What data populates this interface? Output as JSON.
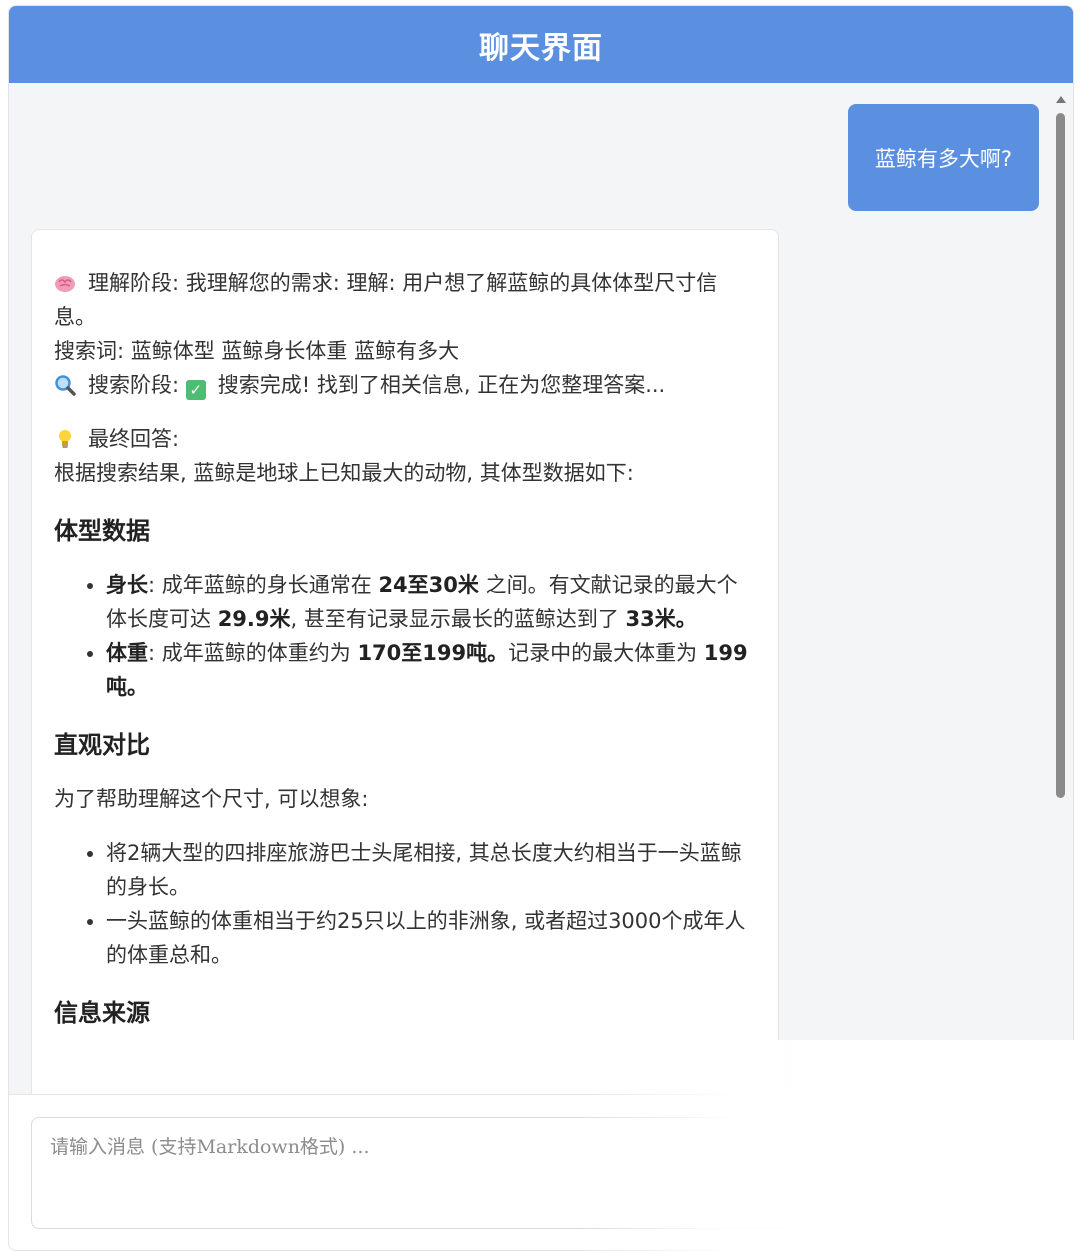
{
  "header": {
    "title": "聊天界面"
  },
  "messages": {
    "user": "蓝鲸有多大啊?",
    "ai": {
      "understanding_label": "理解阶段:",
      "understanding_text": "我理解您的需求: 理解: 用户想了解蓝鲸的具体体型尺寸信息。",
      "keywords": "搜索词: 蓝鲸体型 蓝鲸身长体重 蓝鲸有多大",
      "search_label": "搜索阶段:",
      "search_text": "搜索完成! 找到了相关信息, 正在为您整理答案...",
      "final_label": "最终回答:",
      "intro": "根据搜索结果, 蓝鲸是地球上已知最大的动物, 其体型数据如下:",
      "section1_title": "体型数据",
      "length_label": "身长",
      "length_a": ": 成年蓝鲸的身长通常在 ",
      "length_b": "24至30米",
      "length_c": " 之间。有文献记录的最大个体长度可达 ",
      "length_d": "29.9米",
      "length_e": ", 甚至有记录显示最长的蓝鲸达到了 ",
      "length_f": "33米。",
      "weight_label": "体重",
      "weight_a": ": 成年蓝鲸的体重约为 ",
      "weight_b": "170至199吨。",
      "weight_c": "记录中的最大体重为 ",
      "weight_d": "199吨。",
      "section2_title": "直观对比",
      "compare_intro": "为了帮助理解这个尺寸, 可以想象:",
      "compare_items": [
        "将2辆大型的四排座旅游巴士头尾相接, 其总长度大约相当于一头蓝鲸的身长。",
        "一头蓝鲸的体重相当于约25只以上的非洲象, 或者超过3000个成年人的体重总和。"
      ],
      "section3_title": "信息来源"
    }
  },
  "input": {
    "placeholder": "请输入消息 (支持Markdown格式) ..."
  },
  "icons": {
    "brain": "brain-icon",
    "search": "magnifier-icon",
    "check": "check-icon",
    "bulb": "lightbulb-icon"
  }
}
